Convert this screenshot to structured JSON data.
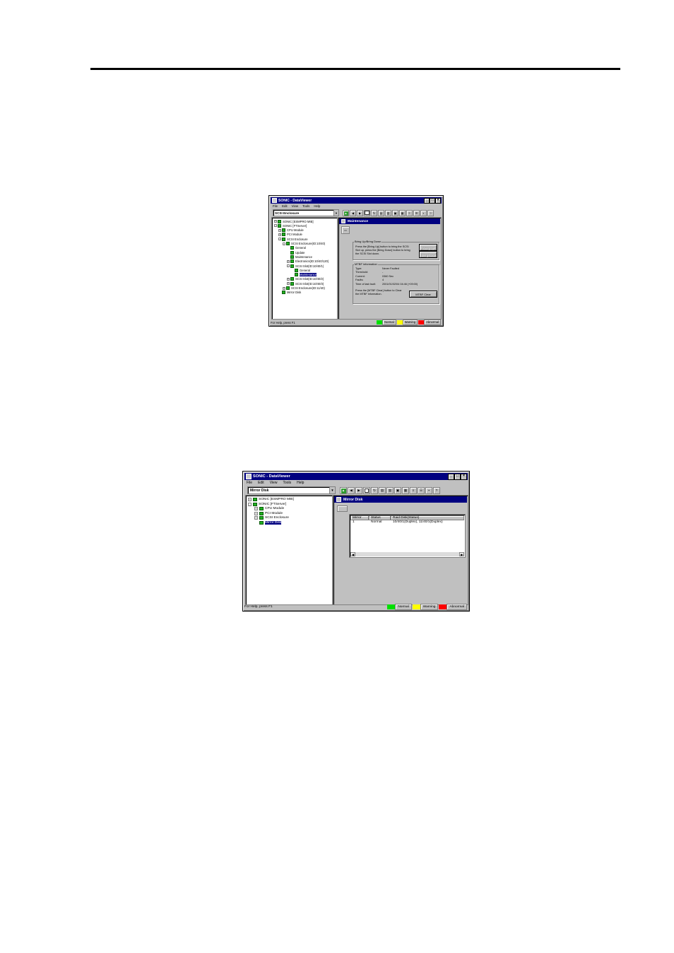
{
  "colors": {
    "title_bar": "#000080",
    "status_normal": "#00e000",
    "status_warning": "#ffff00",
    "status_abnormal": "#ff0000",
    "window_face": "#c0c0c0"
  },
  "window1": {
    "title": "SONIC - DataViewer",
    "menu": [
      "File",
      "Edit",
      "View",
      "Tools",
      "Help"
    ],
    "combo_value": "SCSI Enclosure",
    "tree": [
      {
        "label": "SONIC [ESMPRO MIB]",
        "depth": 0,
        "expander": "+"
      },
      {
        "label": "SONIC [FTServer]",
        "depth": 0,
        "expander": "-"
      },
      {
        "label": "CPU Module",
        "depth": 1,
        "expander": "+"
      },
      {
        "label": "PCI Module",
        "depth": 1,
        "expander": "+"
      },
      {
        "label": "SCSI Enclosure",
        "depth": 1,
        "expander": "-"
      },
      {
        "label": "SCSI Enclosure(ID:10/40)",
        "depth": 2,
        "expander": "-"
      },
      {
        "label": "General",
        "depth": 3,
        "expander": ""
      },
      {
        "label": "Update",
        "depth": 3,
        "expander": ""
      },
      {
        "label": "Maintenance",
        "depth": 3,
        "expander": ""
      },
      {
        "label": "Electronics(ID:10/40/120)",
        "depth": 3,
        "expander": "+"
      },
      {
        "label": "SCSI Slot(ID:10/40/1)",
        "depth": 3,
        "expander": "-"
      },
      {
        "label": "General",
        "depth": 4,
        "expander": ""
      },
      {
        "label": "Maintenance",
        "depth": 4,
        "expander": "",
        "selected": true
      },
      {
        "label": "SCSI Slot(ID:10/40/2)",
        "depth": 3,
        "expander": "+"
      },
      {
        "label": "SCSI Slot(ID:10/40/3)",
        "depth": 3,
        "expander": "+"
      },
      {
        "label": "SCSI Enclosure(ID:11/40)",
        "depth": 2,
        "expander": "+"
      },
      {
        "label": "Mirror Disk",
        "depth": 1,
        "expander": ""
      }
    ],
    "panel_title": "Maintenance",
    "bring": {
      "group_title": "Bring Up/Bring Down",
      "text_lines": [
        "Press the [Bring Up] button to bring the SCSI",
        "Slot up, press the [Bring Down] button to bring",
        "the SCSI Slot down."
      ],
      "bring_up_label": "Bring Up",
      "bring_down_label": "Bring Down"
    },
    "mtbf": {
      "group_title": "MTBF information",
      "rows": [
        {
          "label": "Type:",
          "value": "Never Faulted"
        },
        {
          "label": "Threshold:",
          "value": "-"
        },
        {
          "label": "Current:",
          "value": "0360 Sec"
        },
        {
          "label": "Faults:",
          "value": "4"
        },
        {
          "label": "Time of last fault:",
          "value": "2001/01/02/04 04:46 (+09:00)"
        }
      ],
      "clear_text_lines": [
        "Press the [MTBF Clear] button to Clear",
        "the MTBF information."
      ],
      "clear_button_label": "MTBF Clear"
    },
    "status_help": "For Help, press F1",
    "legend": [
      "Normal",
      "Warning",
      "Abnormal"
    ]
  },
  "window2": {
    "title": "SONIC - DataViewer",
    "menu": [
      "File",
      "Edit",
      "View",
      "Tools",
      "Help"
    ],
    "combo_value": "Mirror Disk",
    "tree": [
      {
        "label": "SONIC [ESMPRO MIB]",
        "depth": 0,
        "expander": "+"
      },
      {
        "label": "SONIC [FTServer]",
        "depth": 0,
        "expander": "-"
      },
      {
        "label": "CPU Module",
        "depth": 1,
        "expander": "+"
      },
      {
        "label": "PCI Module",
        "depth": 1,
        "expander": "+"
      },
      {
        "label": "SCSI Enclosure",
        "depth": 1,
        "expander": "+"
      },
      {
        "label": "Mirror Disk",
        "depth": 1,
        "expander": "",
        "selected": true
      }
    ],
    "panel_title": "Mirror Disk",
    "columns": [
      "Mirror",
      "Status",
      "Raid Disk(Status)"
    ],
    "rows": [
      [
        "1",
        "Normal",
        "10/40/1(Duplex), 11/40/1(Duplex)"
      ]
    ],
    "status_help": "For Help, press F1",
    "legend": [
      "Normal",
      "Warning",
      "Abnormal"
    ]
  }
}
